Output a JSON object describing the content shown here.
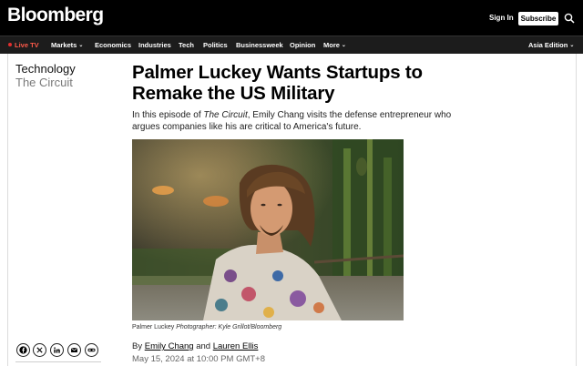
{
  "header": {
    "logo": "Bloomberg",
    "sign_in": "Sign In",
    "subscribe": "Subscribe",
    "search_icon": "search-icon"
  },
  "nav": {
    "live": "Live TV",
    "items": [
      "Markets",
      "Economics",
      "Industries",
      "Tech",
      "Politics",
      "Businessweek",
      "Opinion",
      "More"
    ],
    "edition": "Asia Edition",
    "live_color": "#ff5a4a"
  },
  "article": {
    "section": "Technology",
    "series": "The Circuit",
    "headline": "Palmer Luckey Wants Startups to Remake the US Military",
    "dek_pre": "In this episode of ",
    "dek_italic": "The Circuit",
    "dek_post": ", Emily Chang visits the defense entrepreneur who argues companies like his are critical to America's future.",
    "caption_name": "Palmer Luckey",
    "caption_credit": "Photographer: Kyle Grillot/Bloomberg",
    "by": "By",
    "author1": "Emily Chang",
    "and": "and",
    "author2": "Lauren Ellis",
    "date": "May 15, 2024 at 10:00 PM GMT+8"
  },
  "share": {
    "icons": [
      "facebook-icon",
      "x-icon",
      "linkedin-icon",
      "email-icon",
      "link-icon"
    ]
  }
}
